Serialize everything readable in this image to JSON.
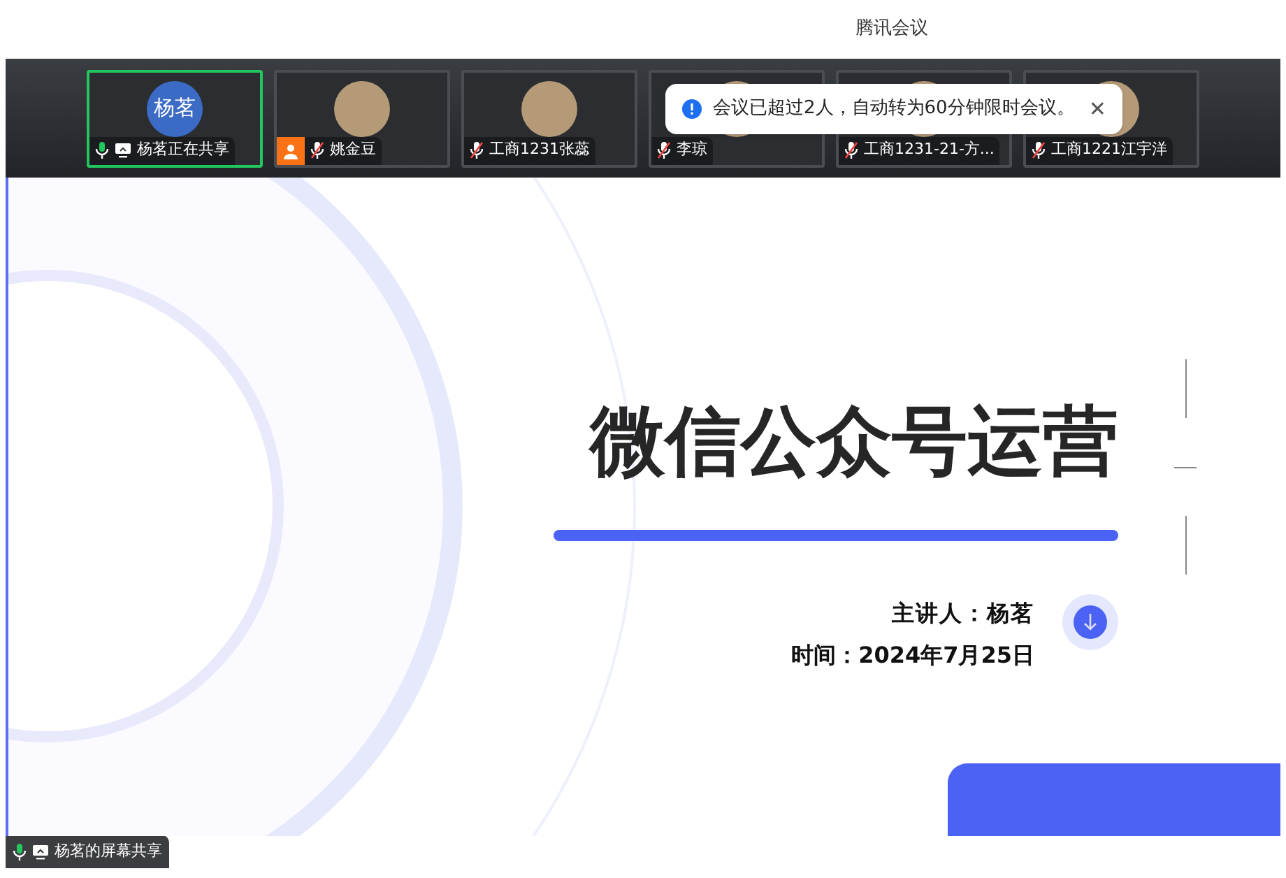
{
  "window": {
    "title": "腾讯会议"
  },
  "participants": [
    {
      "name": "杨茗正在共享",
      "muted": false,
      "sharing": true,
      "active": true,
      "host": false,
      "avatar": {
        "kind": "initials",
        "text": "杨茗"
      }
    },
    {
      "name": "姚金豆",
      "muted": true,
      "sharing": false,
      "active": false,
      "host": true,
      "avatar": {
        "kind": "photo"
      }
    },
    {
      "name": "工商1231张蕊",
      "muted": true,
      "sharing": false,
      "active": false,
      "host": false,
      "avatar": {
        "kind": "photo"
      }
    },
    {
      "name": "李琼",
      "muted": true,
      "sharing": false,
      "active": false,
      "host": false,
      "avatar": {
        "kind": "photo"
      }
    },
    {
      "name": "工商1231-21-方...",
      "muted": true,
      "sharing": false,
      "active": false,
      "host": false,
      "avatar": {
        "kind": "photo"
      }
    },
    {
      "name": "工商1221江宇洋",
      "muted": true,
      "sharing": false,
      "active": false,
      "host": false,
      "avatar": {
        "kind": "photo"
      }
    }
  ],
  "toast": {
    "message": "会议已超过2人，自动转为60分钟限时会议。",
    "close": "✕"
  },
  "slide": {
    "title": "微信公众号运营",
    "speaker": "主讲人：杨茗",
    "date": "时间：2024年7月25日"
  },
  "share_label": {
    "text": "杨茗的屏幕共享",
    "muted": false
  }
}
